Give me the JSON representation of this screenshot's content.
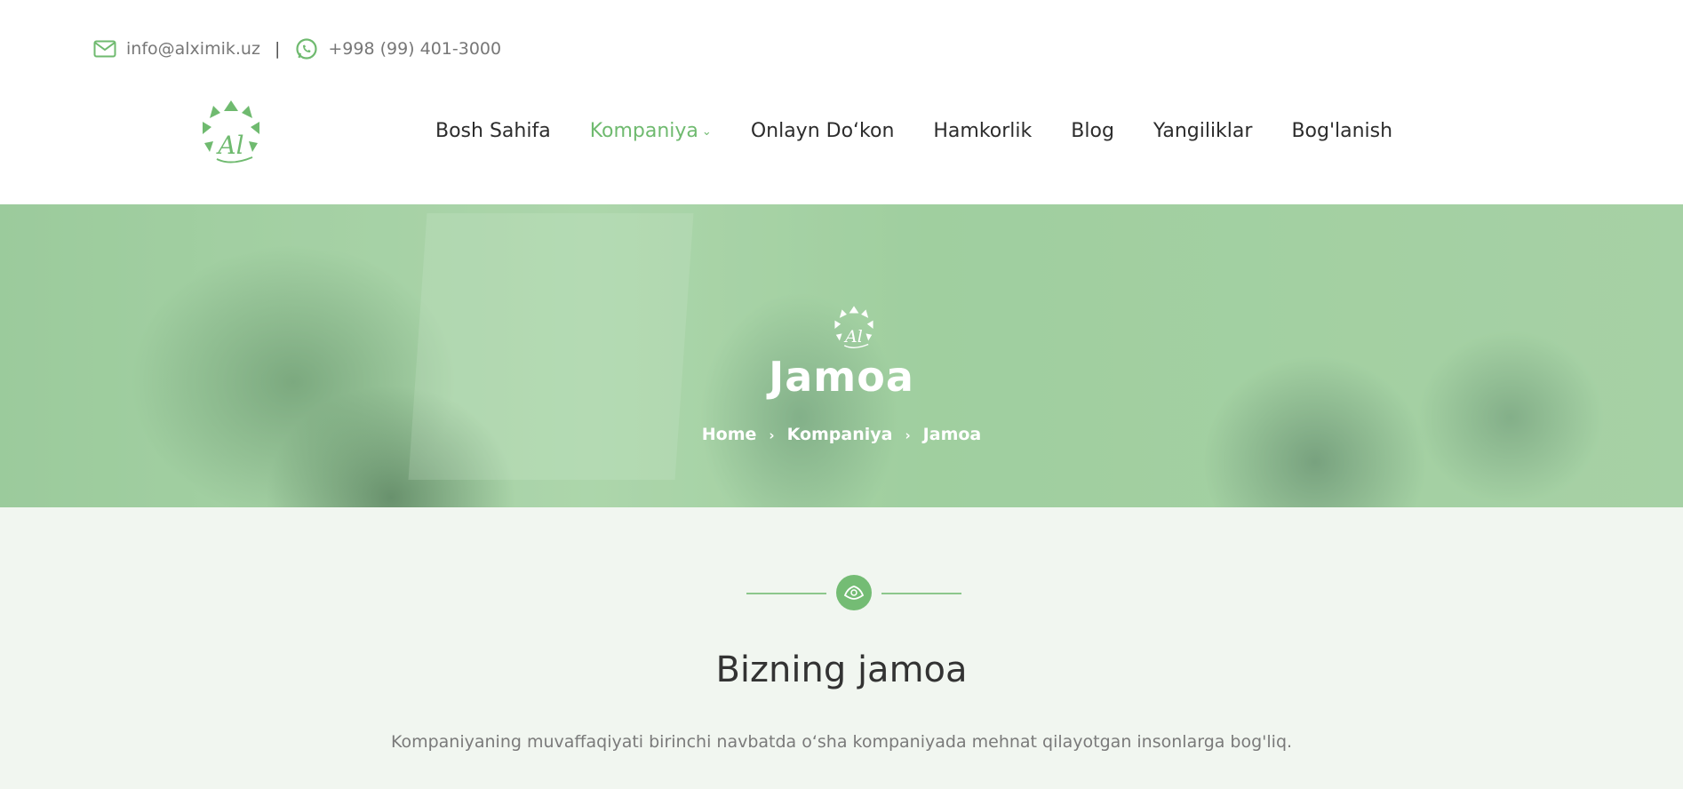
{
  "topbar": {
    "email": "info@alximik.uz",
    "separator": "|",
    "phone": "+998 (99) 401-3000",
    "email_icon": "mail-icon",
    "phone_icon": "whatsapp-icon"
  },
  "nav": {
    "items": [
      {
        "label": "Bosh Sahifa"
      },
      {
        "label": "Kompaniya"
      },
      {
        "label": "Onlayn Do‘kon"
      },
      {
        "label": "Hamkorlik"
      },
      {
        "label": "Blog"
      },
      {
        "label": "Yangiliklar"
      },
      {
        "label": "Bog'lanish"
      }
    ]
  },
  "hero": {
    "title": "Jamoa",
    "breadcrumb": [
      "Home",
      "Kompaniya",
      "Jamoa"
    ]
  },
  "section": {
    "title": "Bizning jamoa",
    "text": "Kompaniyaning muvaffaqiyati birinchi navbatda o‘sha kompaniyada mehnat qilayotgan insonlarga bog'liq."
  },
  "colors": {
    "accent": "#6fba6f",
    "hero_tint": "#a8d4a6",
    "content_bg": "#f1f6f0"
  }
}
